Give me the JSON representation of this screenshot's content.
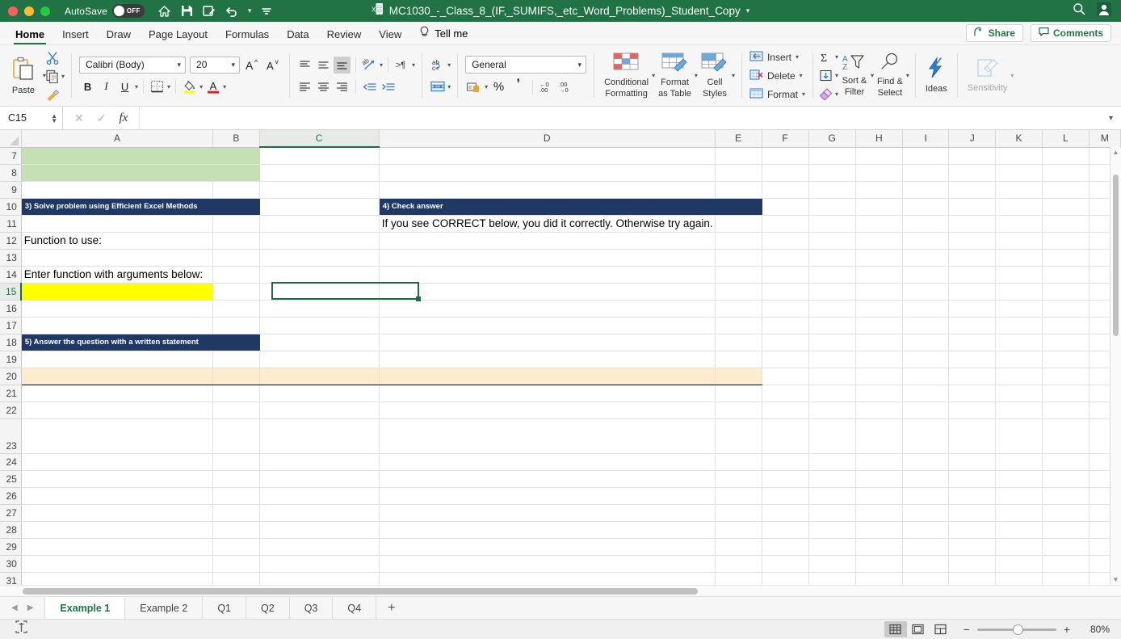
{
  "titlebar": {
    "autosave_label": "AutoSave",
    "autosave_state": "OFF",
    "document_title": "MC1030_-_Class_8_(IF,_SUMIFS,_etc_Word_Problems)_Student_Copy",
    "quick_access": [
      "home-icon",
      "save-icon",
      "edit-icon",
      "undo-icon",
      "customize-icon"
    ],
    "right_icons": [
      "search-icon",
      "account-icon"
    ]
  },
  "ribbon": {
    "tabs": [
      {
        "label": "Home",
        "active": true
      },
      {
        "label": "Insert",
        "active": false
      },
      {
        "label": "Draw",
        "active": false
      },
      {
        "label": "Page Layout",
        "active": false
      },
      {
        "label": "Formulas",
        "active": false
      },
      {
        "label": "Data",
        "active": false
      },
      {
        "label": "Review",
        "active": false
      },
      {
        "label": "View",
        "active": false
      }
    ],
    "tell_me": "Tell me",
    "share_label": "Share",
    "comments_label": "Comments",
    "clipboard": {
      "paste_label": "Paste"
    },
    "font": {
      "family_value": "Calibri (Body)",
      "size_value": "20",
      "bold": "B",
      "italic": "I",
      "underline": "U"
    },
    "number": {
      "format_value": "General",
      "percent": "%",
      "comma": "’"
    },
    "styles": {
      "conditional_formatting": "Conditional\nFormatting",
      "conditional_formatting_l1": "Conditional",
      "conditional_formatting_l2": "Formatting",
      "format_as_table_l1": "Format",
      "format_as_table_l2": "as Table",
      "cell_styles_l1": "Cell",
      "cell_styles_l2": "Styles"
    },
    "cells": {
      "insert": "Insert",
      "delete": "Delete",
      "format": "Format"
    },
    "editing": {
      "sort_filter_l1": "Sort &",
      "sort_filter_l2": "Filter",
      "find_select_l1": "Find &",
      "find_select_l2": "Select"
    },
    "ideas_label": "Ideas",
    "sensitivity_label": "Sensitivity"
  },
  "formula_bar": {
    "name_box": "C15",
    "formula_value": ""
  },
  "grid": {
    "columns": [
      "A",
      "B",
      "C",
      "D",
      "E",
      "F",
      "G",
      "H",
      "I",
      "J",
      "K",
      "L",
      "M"
    ],
    "selected_column": "C",
    "selected_row": "15",
    "selected_cell": "C15",
    "rows": [
      {
        "num": "7",
        "cells": {
          "A": "",
          "B": "",
          "C": "",
          "D": "",
          "E": ""
        }
      },
      {
        "num": "8",
        "cells": {
          "A": "",
          "B": "",
          "C": "",
          "D": "",
          "E": ""
        }
      },
      {
        "num": "9",
        "cells": {
          "A": "",
          "B": "",
          "C": "",
          "D": "",
          "E": ""
        }
      },
      {
        "num": "10",
        "cells": {
          "A": "3) Solve problem using Efficient Excel Methods",
          "B": "",
          "C": "",
          "D": "4) Check answer",
          "E": ""
        }
      },
      {
        "num": "11",
        "cells": {
          "A": "",
          "B": "",
          "C": "",
          "D": "If you see CORRECT below, you did it correctly.  Otherwise try again.",
          "E": ""
        }
      },
      {
        "num": "12",
        "cells": {
          "A": "Function to use:",
          "B": "",
          "C": "",
          "D": "",
          "E": ""
        }
      },
      {
        "num": "13",
        "cells": {
          "A": "",
          "B": "",
          "C": "",
          "D": "",
          "E": ""
        }
      },
      {
        "num": "14",
        "cells": {
          "A": "Enter function with arguments below:",
          "B": "",
          "C": "",
          "D": "",
          "E": ""
        }
      },
      {
        "num": "15",
        "cells": {
          "A": "",
          "B": "",
          "C": "",
          "D": "",
          "E": ""
        }
      },
      {
        "num": "16",
        "cells": {
          "A": "",
          "B": "",
          "C": "",
          "D": "",
          "E": ""
        }
      },
      {
        "num": "17",
        "cells": {
          "A": "",
          "B": "",
          "C": "",
          "D": "",
          "E": ""
        }
      },
      {
        "num": "18",
        "cells": {
          "A": "5) Answer the question with a written statement",
          "B": "",
          "C": "",
          "D": "",
          "E": ""
        }
      },
      {
        "num": "19",
        "cells": {
          "A": "",
          "B": "",
          "C": "",
          "D": "",
          "E": ""
        }
      },
      {
        "num": "20",
        "cells": {
          "A": "",
          "B": "",
          "C": "",
          "D": "",
          "E": ""
        }
      },
      {
        "num": "21",
        "cells": {
          "A": "",
          "B": "",
          "C": "",
          "D": "",
          "E": ""
        }
      },
      {
        "num": "22",
        "cells": {
          "A": "",
          "B": "",
          "C": "",
          "D": "",
          "E": ""
        }
      },
      {
        "num": "23",
        "cells": {
          "A": "",
          "B": "",
          "C": "",
          "D": "",
          "E": ""
        }
      },
      {
        "num": "24",
        "cells": {
          "A": "",
          "B": "",
          "C": "",
          "D": "",
          "E": ""
        }
      },
      {
        "num": "25",
        "cells": {
          "A": "",
          "B": "",
          "C": "",
          "D": "",
          "E": ""
        }
      },
      {
        "num": "26",
        "cells": {
          "A": "",
          "B": "",
          "C": "",
          "D": "",
          "E": ""
        }
      },
      {
        "num": "27",
        "cells": {
          "A": "",
          "B": "",
          "C": "",
          "D": "",
          "E": ""
        }
      },
      {
        "num": "28",
        "cells": {
          "A": "",
          "B": "",
          "C": "",
          "D": "",
          "E": ""
        }
      },
      {
        "num": "29",
        "cells": {
          "A": "",
          "B": "",
          "C": "",
          "D": "",
          "E": ""
        }
      },
      {
        "num": "30",
        "cells": {
          "A": "",
          "B": "",
          "C": "",
          "D": "",
          "E": ""
        }
      },
      {
        "num": "31",
        "cells": {
          "A": "",
          "B": "",
          "C": "",
          "D": "",
          "E": ""
        }
      }
    ],
    "colors": {
      "header_banner": "#1f3864",
      "green_fill": "#c5e0b4",
      "yellow_fill": "#ffff00",
      "cream_fill": "#fdeccd",
      "selection_green": "#1e6b41"
    }
  },
  "sheet_tabs": {
    "tabs": [
      {
        "label": "Example 1",
        "active": true
      },
      {
        "label": "Example 2",
        "active": false
      },
      {
        "label": "Q1",
        "active": false
      },
      {
        "label": "Q2",
        "active": false
      },
      {
        "label": "Q3",
        "active": false
      },
      {
        "label": "Q4",
        "active": false
      }
    ],
    "add_label": "+"
  },
  "status_bar": {
    "zoom_level": "80%",
    "zoom_out": "−",
    "zoom_in": "+",
    "views": [
      "normal-view",
      "page-layout-view",
      "page-break-view"
    ]
  }
}
